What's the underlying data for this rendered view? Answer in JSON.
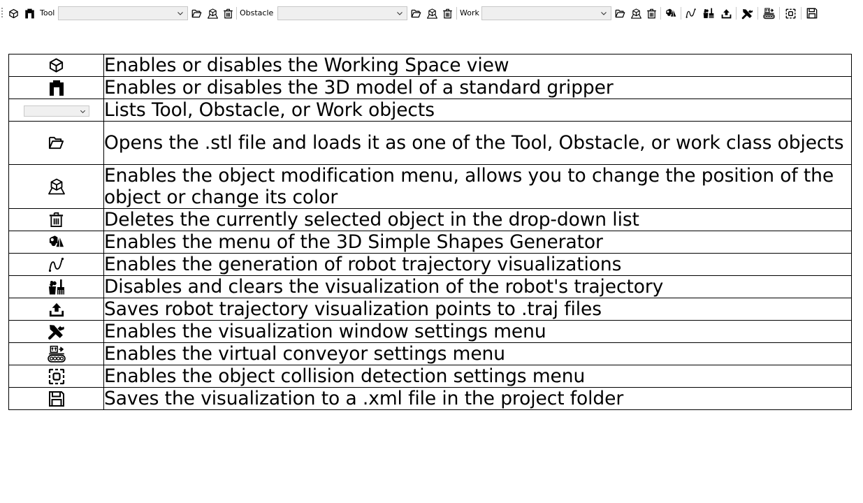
{
  "toolbar": {
    "tool_label": "Tool",
    "obstacle_label": "Obstacle",
    "work_label": "Work",
    "tool_value": "",
    "obstacle_value": "",
    "work_value": "",
    "icons": [
      "cube-outline-icon",
      "gripper-icon",
      "folder-open-icon",
      "object-modify-icon",
      "trash-icon",
      "shapes-generator-icon",
      "trajectory-icon",
      "clear-trajectory-icon",
      "save-trajectory-icon",
      "settings-tools-icon",
      "conveyor-icon",
      "collision-detection-icon",
      "save-disk-icon"
    ]
  },
  "legend": {
    "rows": [
      {
        "icon": "cube-outline-icon",
        "text": "Enables or disables the Working Space view"
      },
      {
        "icon": "gripper-icon",
        "text": "Enables or disables the 3D model of a standard gripper"
      },
      {
        "icon": "combo-box-icon",
        "text": "Lists Tool, Obstacle, or Work objects"
      },
      {
        "icon": "folder-open-icon",
        "text": "Opens the .stl file and loads it as one of the Tool, Obstacle, or work class objects"
      },
      {
        "icon": "object-modify-icon",
        "text": "Enables the object modification menu, allows you to change the position of the object or change its color"
      },
      {
        "icon": "trash-icon",
        "text": "Deletes the currently selected object in the drop-down list"
      },
      {
        "icon": "shapes-generator-icon",
        "text": "Enables the menu of the 3D Simple Shapes Generator"
      },
      {
        "icon": "trajectory-icon",
        "text": "Enables the generation of robot trajectory visualizations"
      },
      {
        "icon": "clear-trajectory-icon",
        "text": "Disables and clears the visualization of the robot's trajectory"
      },
      {
        "icon": "save-trajectory-icon",
        "text": "Saves robot trajectory visualization points to .traj files"
      },
      {
        "icon": "settings-tools-icon",
        "text": "Enables the visualization window settings menu"
      },
      {
        "icon": "conveyor-icon",
        "text": "Enables the virtual conveyor settings menu"
      },
      {
        "icon": "collision-detection-icon",
        "text": "Enables the object collision detection settings menu"
      },
      {
        "icon": "save-disk-icon",
        "text": "Saves the visualization to a .xml file in the project folder"
      }
    ]
  }
}
